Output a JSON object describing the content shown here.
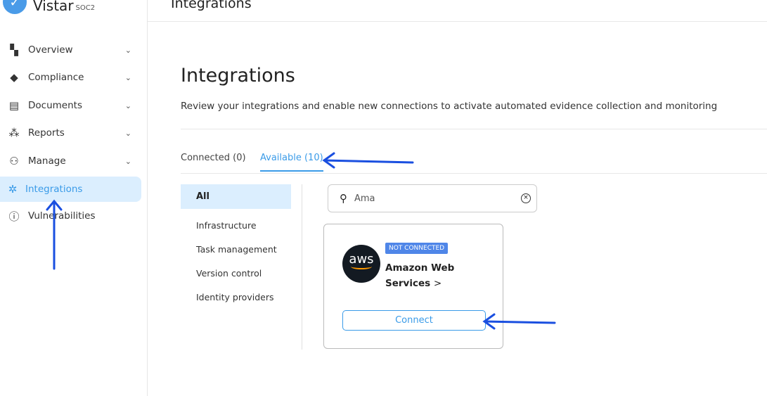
{
  "brand": {
    "name": "Vistar",
    "sub": "SOC2"
  },
  "sidebar": {
    "items": [
      {
        "label": "Overview",
        "icon": "dashboard-icon"
      },
      {
        "label": "Compliance",
        "icon": "diamond-icon"
      },
      {
        "label": "Documents",
        "icon": "document-icon"
      },
      {
        "label": "Reports",
        "icon": "sparkle-chart-icon"
      },
      {
        "label": "Manage",
        "icon": "users-icon"
      },
      {
        "label": "Integrations",
        "icon": "puzzle-icon"
      },
      {
        "label": "Vulnerabilities",
        "icon": "alert-circle-icon"
      }
    ]
  },
  "header": {
    "title": "Integrations"
  },
  "page": {
    "title": "Integrations",
    "description": "Review your integrations and enable new connections to activate automated evidence collection and monitoring"
  },
  "tabs": [
    {
      "label": "Connected (0)"
    },
    {
      "label": "Available (10)"
    }
  ],
  "categories": [
    "All",
    "Infrastructure",
    "Task management",
    "Version control",
    "Identity providers"
  ],
  "search": {
    "value": "Ama"
  },
  "card": {
    "logo": "aws",
    "status": "NOT CONNECTED",
    "name": "Amazon Web Services",
    "chevron": ">",
    "button": "Connect"
  },
  "colors": {
    "accent": "#3a9be8",
    "badge": "#4f86e8",
    "annotation_arrow": "#1a4fe0"
  }
}
